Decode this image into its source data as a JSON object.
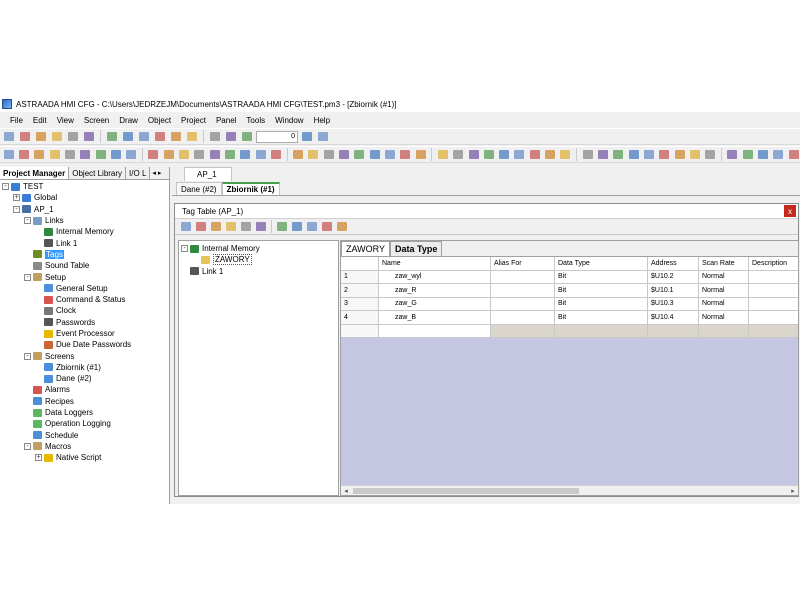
{
  "window": {
    "title": "ASTRAADA HMI CFG - C:\\Users\\JEDRZEJM\\Documents\\ASTRAADA HMI CFG\\TEST.pm3 - [Zbiornik (#1)]"
  },
  "menu": [
    "File",
    "Edit",
    "View",
    "Screen",
    "Draw",
    "Object",
    "Project",
    "Panel",
    "Tools",
    "Window",
    "Help"
  ],
  "toolbar": {
    "zoom_value": "0"
  },
  "project_manager": {
    "tabs": [
      "Project Manager",
      "Object Library",
      "I/O L"
    ],
    "arrows": [
      "◂",
      "▸"
    ],
    "tree": [
      {
        "label": "TEST",
        "depth": 0,
        "exp": "-",
        "color": "#3a7bd5"
      },
      {
        "label": "Global",
        "depth": 1,
        "exp": "+",
        "color": "#3a7bd5"
      },
      {
        "label": "AP_1",
        "depth": 1,
        "exp": "-",
        "color": "#4a6fa5"
      },
      {
        "label": "Links",
        "depth": 2,
        "exp": "-",
        "color": "#7a9cc6"
      },
      {
        "label": "Internal Memory",
        "depth": 3,
        "exp": "",
        "color": "#2e8b3e"
      },
      {
        "label": "Link 1",
        "depth": 3,
        "exp": "",
        "color": "#555555"
      },
      {
        "label": "Tags",
        "depth": 2,
        "exp": "",
        "color": "#6b8e23",
        "selected": true
      },
      {
        "label": "Sound Table",
        "depth": 2,
        "exp": "",
        "color": "#8a8a8a"
      },
      {
        "label": "Setup",
        "depth": 2,
        "exp": "-",
        "color": "#c0a060"
      },
      {
        "label": "General Setup",
        "depth": 3,
        "exp": "",
        "color": "#4a90d9"
      },
      {
        "label": "Command & Status",
        "depth": 3,
        "exp": "",
        "color": "#d9534f"
      },
      {
        "label": "Clock",
        "depth": 3,
        "exp": "",
        "color": "#777777"
      },
      {
        "label": "Passwords",
        "depth": 3,
        "exp": "",
        "color": "#555555"
      },
      {
        "label": "Event Processor",
        "depth": 3,
        "exp": "",
        "color": "#e6b800"
      },
      {
        "label": "Due Date Passwords",
        "depth": 3,
        "exp": "",
        "color": "#cc6633"
      },
      {
        "label": "Screens",
        "depth": 2,
        "exp": "-",
        "color": "#c0a060"
      },
      {
        "label": "Zbiornik (#1)",
        "depth": 3,
        "exp": "",
        "color": "#4a90d9"
      },
      {
        "label": "Dane (#2)",
        "depth": 3,
        "exp": "",
        "color": "#4a90d9"
      },
      {
        "label": "Alarms",
        "depth": 2,
        "exp": "",
        "color": "#d9534f"
      },
      {
        "label": "Recipes",
        "depth": 2,
        "exp": "",
        "color": "#4a90d9"
      },
      {
        "label": "Data Loggers",
        "depth": 2,
        "exp": "",
        "color": "#5cb85c"
      },
      {
        "label": "Operation Logging",
        "depth": 2,
        "exp": "",
        "color": "#5cb85c"
      },
      {
        "label": "Schedule",
        "depth": 2,
        "exp": "",
        "color": "#4a90d9"
      },
      {
        "label": "Macros",
        "depth": 2,
        "exp": "-",
        "color": "#c0a060"
      },
      {
        "label": "Native Script",
        "depth": 3,
        "exp": "+",
        "color": "#e6b800"
      }
    ]
  },
  "doc_tabs": {
    "top": "AP_1",
    "bottom": [
      "Dane (#2)",
      "Zbiornik (#1)"
    ],
    "active": 1
  },
  "tag_table": {
    "title": "Tag Table (AP_1)",
    "close": "x",
    "tree": [
      {
        "label": "Internal Memory",
        "depth": 0,
        "exp": "-",
        "color": "#2e8b3e"
      },
      {
        "label": "ZAWORY",
        "depth": 1,
        "exp": "",
        "color": "#e6c35c",
        "boxed": true
      },
      {
        "label": "Link 1",
        "depth": 0,
        "exp": "",
        "color": "#555555"
      }
    ],
    "sheet_tabs": [
      "ZAWORY",
      "Data Type"
    ],
    "columns": [
      "",
      "Name",
      "Alias For",
      "Data Type",
      "Address",
      "Scan Rate",
      "Description"
    ],
    "rows": [
      [
        "1",
        "zaw_wyl",
        "",
        "Bit",
        "$U10.2",
        "Normal",
        ""
      ],
      [
        "2",
        "zaw_R",
        "",
        "Bit",
        "$U10.1",
        "Normal",
        ""
      ],
      [
        "3",
        "zaw_G",
        "",
        "Bit",
        "$U10.3",
        "Normal",
        ""
      ],
      [
        "4",
        "zaw_B",
        "",
        "Bit",
        "$U10.4",
        "Normal",
        ""
      ]
    ],
    "scroll_arrows": [
      "◂",
      "▸"
    ]
  },
  "colors": {
    "accent": "#3399ff",
    "grid_bg": "#c4c6e2",
    "active_tab_bar": "#44a048"
  }
}
